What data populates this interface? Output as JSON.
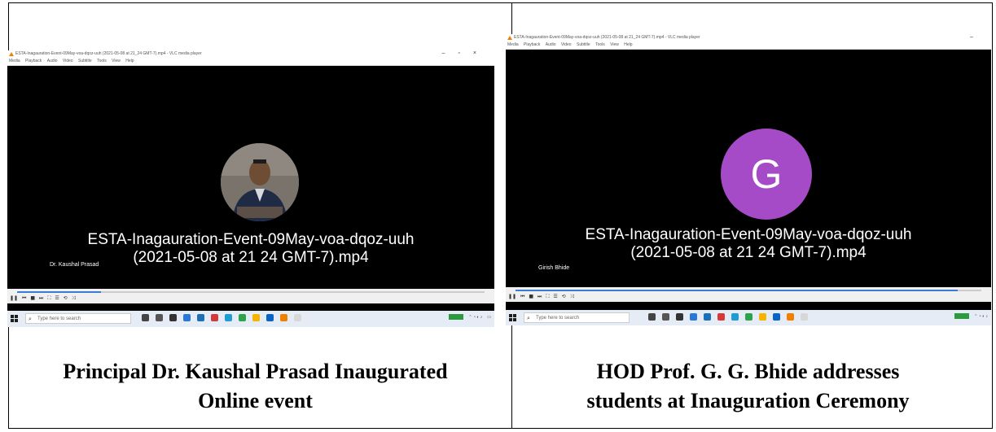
{
  "left_panel": {
    "window_title": "ESTA-Inagauration-Event-09May-voa-dqoz-uuh (2021-05-08 at 21_24 GMT-7).mp4 - VLC media player",
    "menu": [
      "Media",
      "Playback",
      "Audio",
      "Video",
      "Subtitle",
      "Tools",
      "View",
      "Help"
    ],
    "video_title_line1": "ESTA-Inagauration-Event-09May-voa-dqoz-uuh",
    "video_title_line2": "(2021-05-08 at 21  24 GMT-7).mp4",
    "speaker": "Dr. Kaushal Prasad",
    "search_placeholder": "Type here to search",
    "progress": 0.18,
    "caption_line1": "Principal Dr. Kaushal Prasad Inaugurated",
    "caption_line2": "Online event"
  },
  "right_panel": {
    "window_title": "ESTA-Inagauration-Event-09May-voa-dqoz-uuh (2021-05-08 at 21_24 GMT-7).mp4 - VLC media player",
    "menu": [
      "Media",
      "Playback",
      "Audio",
      "Video",
      "Subtitle",
      "Tools",
      "View",
      "Help"
    ],
    "avatar_letter": "G",
    "avatar_color": "#a64bc7",
    "video_title_line1": "ESTA-Inagauration-Event-09May-voa-dqoz-uuh",
    "video_title_line2": "(2021-05-08 at 21  24 GMT-7).mp4",
    "speaker": "Girish Bhide",
    "search_placeholder": "Type here to search",
    "progress": 0.95,
    "caption_line1": "HOD  Prof. G. G. Bhide addresses",
    "caption_line2": "students at Inauguration Ceremony"
  }
}
